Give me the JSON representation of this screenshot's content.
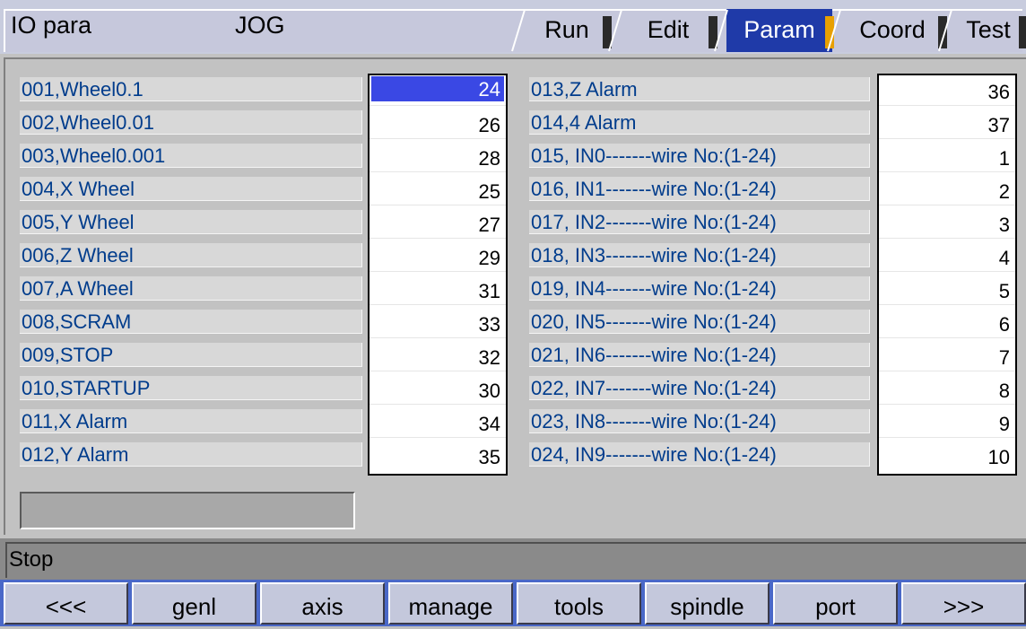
{
  "header": {
    "title": "IO para",
    "mode": "JOG",
    "tabs": [
      {
        "label": "Run",
        "active": false
      },
      {
        "label": "Edit",
        "active": false
      },
      {
        "label": "Param",
        "active": true
      },
      {
        "label": "Coord",
        "active": false
      },
      {
        "label": "Test",
        "active": false
      }
    ]
  },
  "params_left": [
    {
      "label": "001,Wheel0.1",
      "value": "24",
      "selected": true
    },
    {
      "label": "002,Wheel0.01",
      "value": "26"
    },
    {
      "label": "003,Wheel0.001",
      "value": "28"
    },
    {
      "label": "004,X Wheel",
      "value": "25"
    },
    {
      "label": "005,Y Wheel",
      "value": "27"
    },
    {
      "label": "006,Z Wheel",
      "value": "29"
    },
    {
      "label": "007,A Wheel",
      "value": "31"
    },
    {
      "label": "008,SCRAM",
      "value": "33"
    },
    {
      "label": "009,STOP",
      "value": "32"
    },
    {
      "label": "010,STARTUP",
      "value": "30"
    },
    {
      "label": "011,X Alarm",
      "value": "34"
    },
    {
      "label": "012,Y Alarm",
      "value": "35"
    }
  ],
  "params_right": [
    {
      "label": "013,Z Alarm",
      "value": "36"
    },
    {
      "label": "014,4 Alarm",
      "value": "37"
    },
    {
      "label": "015, IN0-------wire No:(1-24)",
      "value": "1"
    },
    {
      "label": "016, IN1-------wire No:(1-24)",
      "value": "2"
    },
    {
      "label": "017, IN2-------wire No:(1-24)",
      "value": "3"
    },
    {
      "label": "018, IN3-------wire No:(1-24)",
      "value": "4"
    },
    {
      "label": "019, IN4-------wire No:(1-24)",
      "value": "5"
    },
    {
      "label": "020, IN5-------wire No:(1-24)",
      "value": "6"
    },
    {
      "label": "021, IN6-------wire No:(1-24)",
      "value": "7"
    },
    {
      "label": "022, IN7-------wire No:(1-24)",
      "value": "8"
    },
    {
      "label": "023, IN8-------wire No:(1-24)",
      "value": "9"
    },
    {
      "label": "024, IN9-------wire No:(1-24)",
      "value": "10"
    }
  ],
  "edit_field": {
    "value": ""
  },
  "status": {
    "text": "Stop"
  },
  "buttons": [
    "<<<",
    "genl",
    "axis",
    "manage",
    "tools",
    "spindle",
    "port",
    ">>>"
  ],
  "colors": {
    "label_text": "#003c8c",
    "active_tab": "#1f3aa8",
    "selection": "#3a48e4",
    "button_bar": "#4a68c8"
  }
}
